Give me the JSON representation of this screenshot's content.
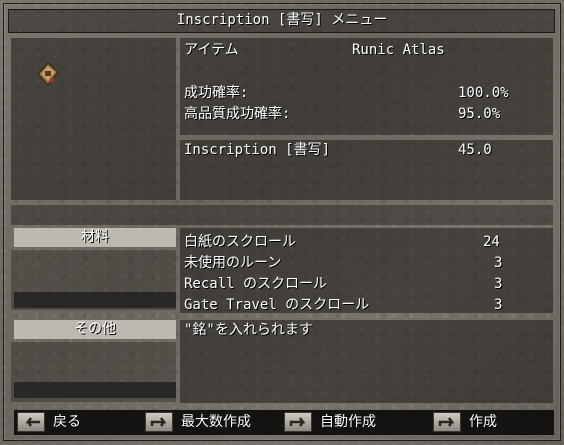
{
  "window": {
    "title": "Inscription [書写] メニュー"
  },
  "item": {
    "label": "アイテム",
    "name": "Runic Atlas",
    "icon": "runic-atlas-icon"
  },
  "stats": {
    "success_label": "成功確率:",
    "success_value": "100.0%",
    "exceptional_label": "高品質成功確率:",
    "exceptional_value": "95.0%"
  },
  "skill": {
    "name": "Inscription [書写]",
    "value": "45.0"
  },
  "materials": {
    "header": "材料",
    "rows": [
      {
        "name": "白紙のスクロール",
        "qty": "24"
      },
      {
        "name": "未使用のルーン",
        "qty": "3"
      },
      {
        "name": "Recall のスクロール",
        "qty": "3"
      },
      {
        "name": "Gate Travel のスクロール",
        "qty": "3"
      }
    ]
  },
  "other": {
    "header": "その他",
    "note": "\"銘\"を入れられます"
  },
  "buttons": {
    "back": "戻る",
    "make_max": "最大数作成",
    "auto": "自動作成",
    "make": "作成"
  }
}
